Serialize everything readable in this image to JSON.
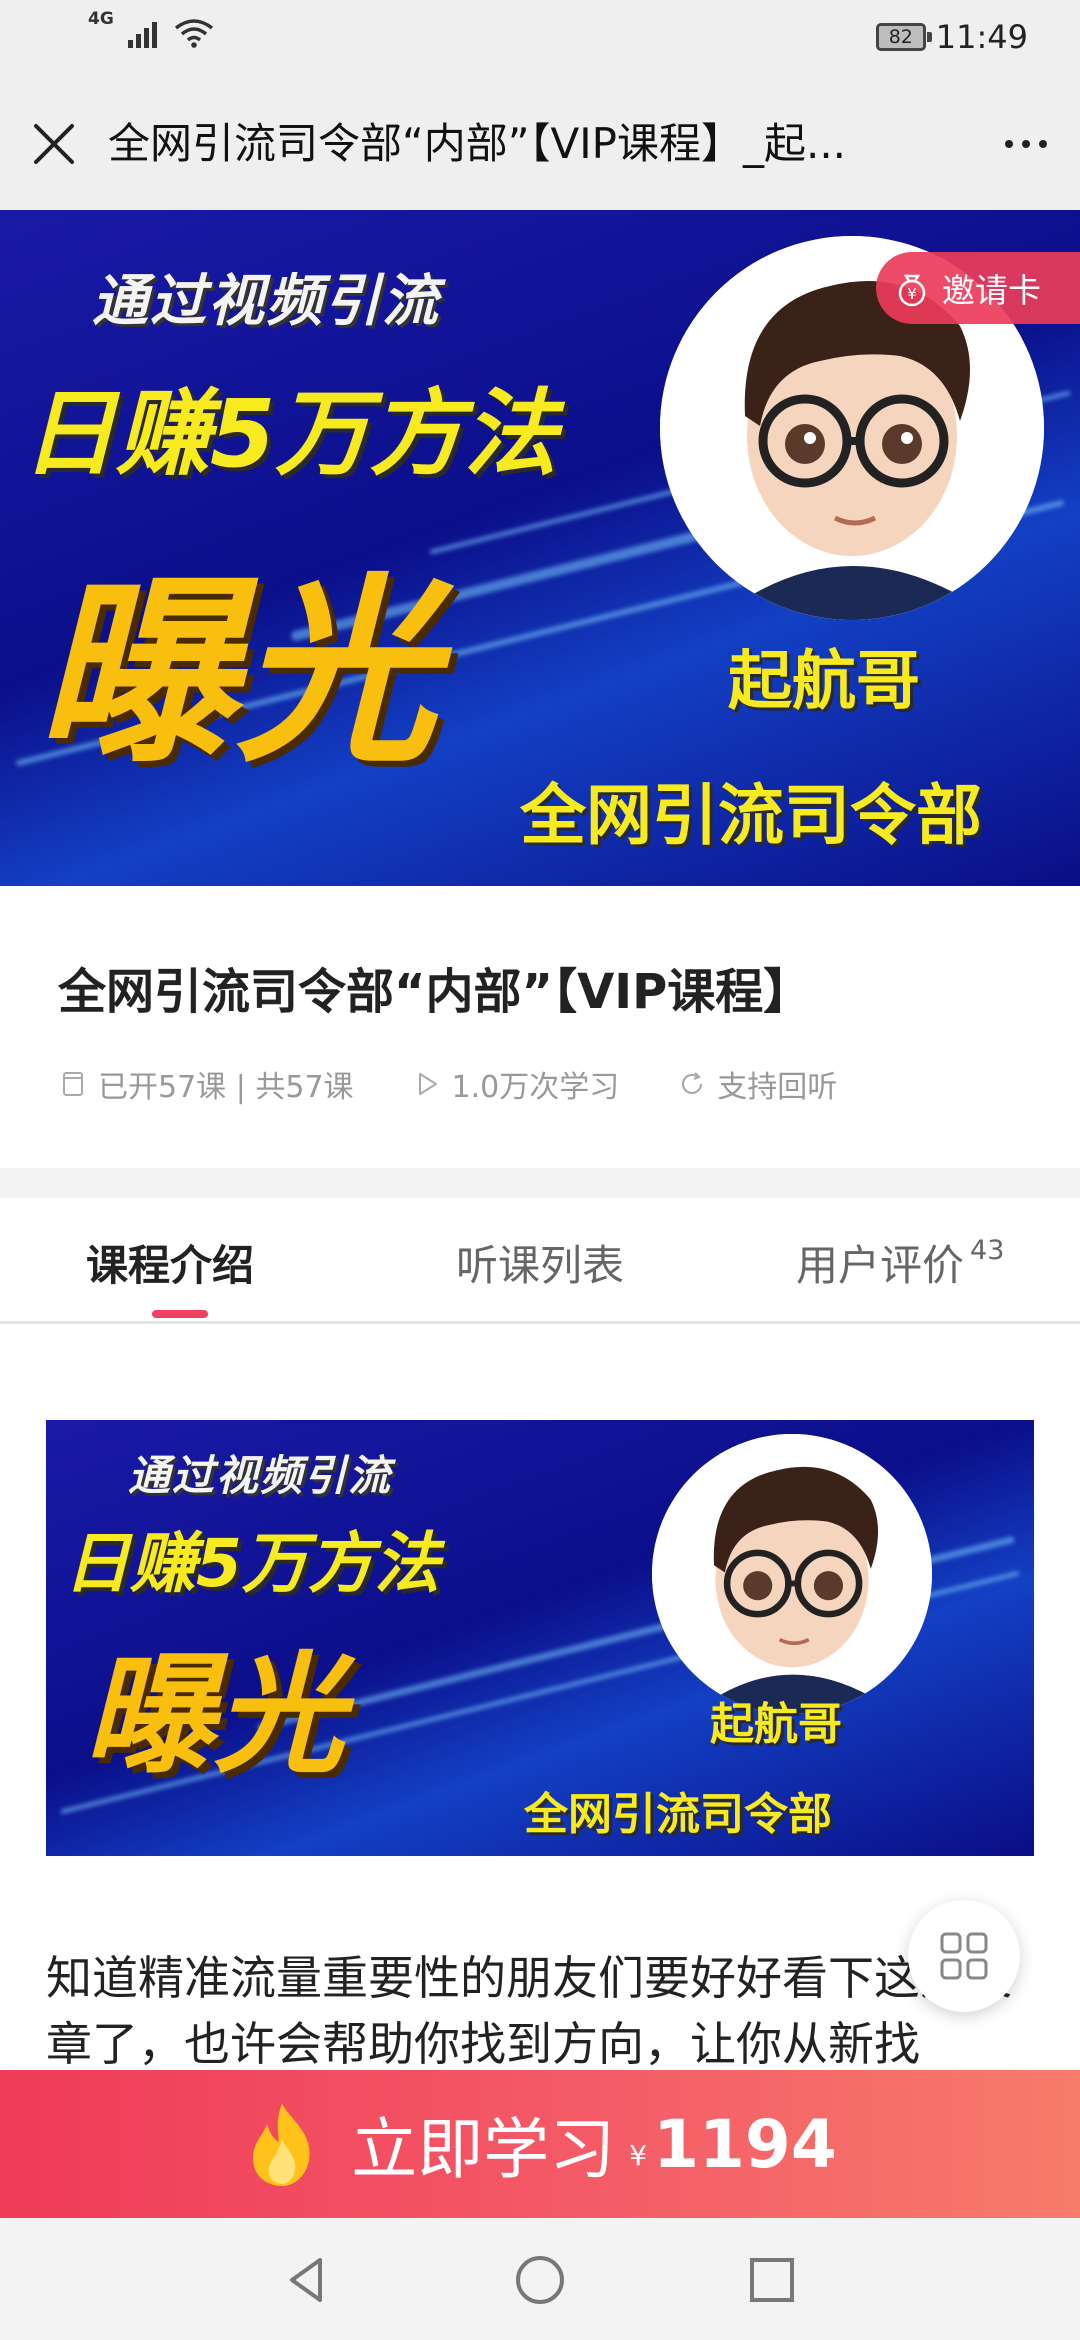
{
  "status_bar": {
    "network": "4G",
    "battery": "82",
    "time": "11:49"
  },
  "title_bar": {
    "title": "全网引流司令部“内部”【VIP课程】_起..."
  },
  "banner": {
    "line1": "通过视频引流",
    "line2": "日赚5万方法",
    "line3": "曝光",
    "name": "起航哥",
    "brand": "全网引流司令部",
    "invite_label": "邀请卡"
  },
  "course": {
    "title": "全网引流司令部“内部”【VIP课程】",
    "lessons": "已开57课 | 共57课",
    "learners": "1.0万次学习",
    "replay": "支持回听"
  },
  "tabs": {
    "intro": "课程介绍",
    "list": "听课列表",
    "reviews": "用户评价",
    "reviews_count": "43"
  },
  "content": {
    "intro_text": "知道精准流量重要性的朋友们要好好看下这篇文章了，也许会帮助你找到方向，让你从新找"
  },
  "cta": {
    "label": "立即学习",
    "currency": "¥",
    "price": "1194"
  },
  "colors": {
    "accent": "#f04160",
    "cta_start": "#ef3b58",
    "cta_end": "#f77c6a",
    "banner_blue": "#0b0f8a"
  }
}
